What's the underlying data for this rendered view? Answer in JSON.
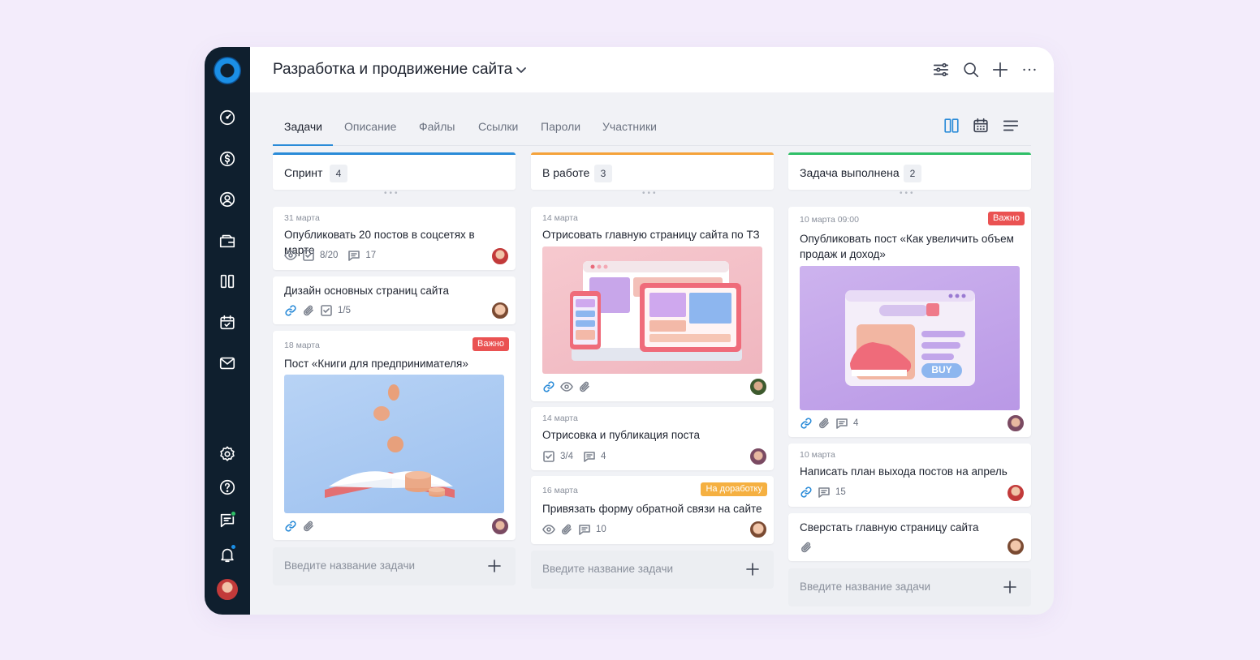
{
  "header": {
    "title": "Разработка и продвижение сайта"
  },
  "tabs": [
    "Задачи",
    "Описание",
    "Файлы",
    "Ссылки",
    "Пароли",
    "Участники"
  ],
  "add_placeholder": "Введите название задачи",
  "colors": {
    "sprint": "#2a8bd8",
    "work": "#f5a23a",
    "done": "#2fbf67",
    "important": "#ea5252",
    "rework": "#f5b041"
  },
  "columns": [
    {
      "title": "Спринт",
      "count": "4",
      "cards": [
        {
          "date": "31 марта",
          "title": "Опубликовать 20 постов в соцсетях в марте",
          "checks": "8/20",
          "comments": "17"
        },
        {
          "title": "Дизайн основных страниц сайта",
          "checks": "1/5"
        },
        {
          "date": "18 марта",
          "badge": "Важно",
          "title": "Пост «Книги для предпринимателя»",
          "image": "book-with-coins"
        }
      ]
    },
    {
      "title": "В работе",
      "count": "3",
      "cards": [
        {
          "date": "14 марта",
          "title": "Отрисовать главную страницу сайта по ТЗ",
          "image": "devices-illustration"
        },
        {
          "date": "14 марта",
          "title": "Отрисовка и публикация поста",
          "checks": "3/4",
          "comments": "4"
        },
        {
          "date": "16 марта",
          "badge": "На доработку",
          "title": "Привязать форму обратной связи на сайте",
          "comments": "10"
        }
      ]
    },
    {
      "title": "Задача выполнена",
      "count": "2",
      "cards": [
        {
          "date": "10 марта 09:00",
          "badge": "Важно",
          "title": "Опубликовать пост «Как увеличить объем продаж и доход»",
          "image": "sneaker-shop",
          "buy_label": "BUY",
          "comments": "4"
        },
        {
          "date": "10 марта",
          "title": "Написать план выхода постов на апрель",
          "comments": "15"
        },
        {
          "title": "Сверстать главную страницу сайта"
        }
      ]
    }
  ]
}
